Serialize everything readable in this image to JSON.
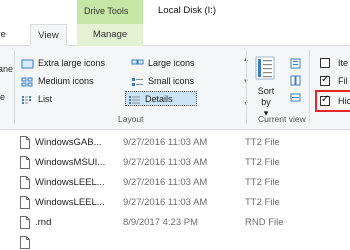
{
  "ribbon_tabs": {
    "context_group": "Drive Tools",
    "share": "are",
    "view": "View",
    "manage": "Manage"
  },
  "window_title": "Local Disk (I:)",
  "nav_pane_fragments": [
    "ane",
    "le"
  ],
  "layout": {
    "items": [
      {
        "label": "Extra large icons",
        "icon": "extra-large-icons-icon",
        "selected": false
      },
      {
        "label": "Large icons",
        "icon": "large-icons-icon",
        "selected": false
      },
      {
        "label": "Medium icons",
        "icon": "medium-icons-icon",
        "selected": false
      },
      {
        "label": "Small icons",
        "icon": "small-icons-icon",
        "selected": false
      },
      {
        "label": "List",
        "icon": "list-icon",
        "selected": false
      },
      {
        "label": "Details",
        "icon": "details-icon",
        "selected": true
      }
    ],
    "group_label": "Layout"
  },
  "current_view": {
    "sort_by": "Sort by",
    "sort_caret": "▾",
    "group_label": "Current view"
  },
  "show_hide": {
    "items": [
      {
        "label": "Ite",
        "checked": false
      },
      {
        "label": "Fil",
        "checked": true
      },
      {
        "label": "Hic",
        "checked": true
      }
    ]
  },
  "files": [
    {
      "name": "WindowsGAB...",
      "date": "9/27/2016 11:03 AM",
      "type": "TT2 File"
    },
    {
      "name": "WindowsMSUI...",
      "date": "9/27/2016 11:03 AM",
      "type": "TT2 File"
    },
    {
      "name": "WindowsLEEL...",
      "date": "9/27/2016 11:03 AM",
      "type": "TT2 File"
    },
    {
      "name": "WindowsLEEL...",
      "date": "9/27/2016 11:03 AM",
      "type": "TT2 File"
    },
    {
      "name": ".rnd",
      "date": "8/9/2017 4:23 PM",
      "type": "RND File"
    },
    {
      "name": "",
      "date": "",
      "type": ""
    }
  ],
  "colors": {
    "context_tab": "#c5e7a5",
    "manage_tab": "#e2f2d3",
    "ribbon_bg": "#f5f6f7",
    "selected_bg": "#cce4f7",
    "highlight_border": "#e3262d"
  }
}
